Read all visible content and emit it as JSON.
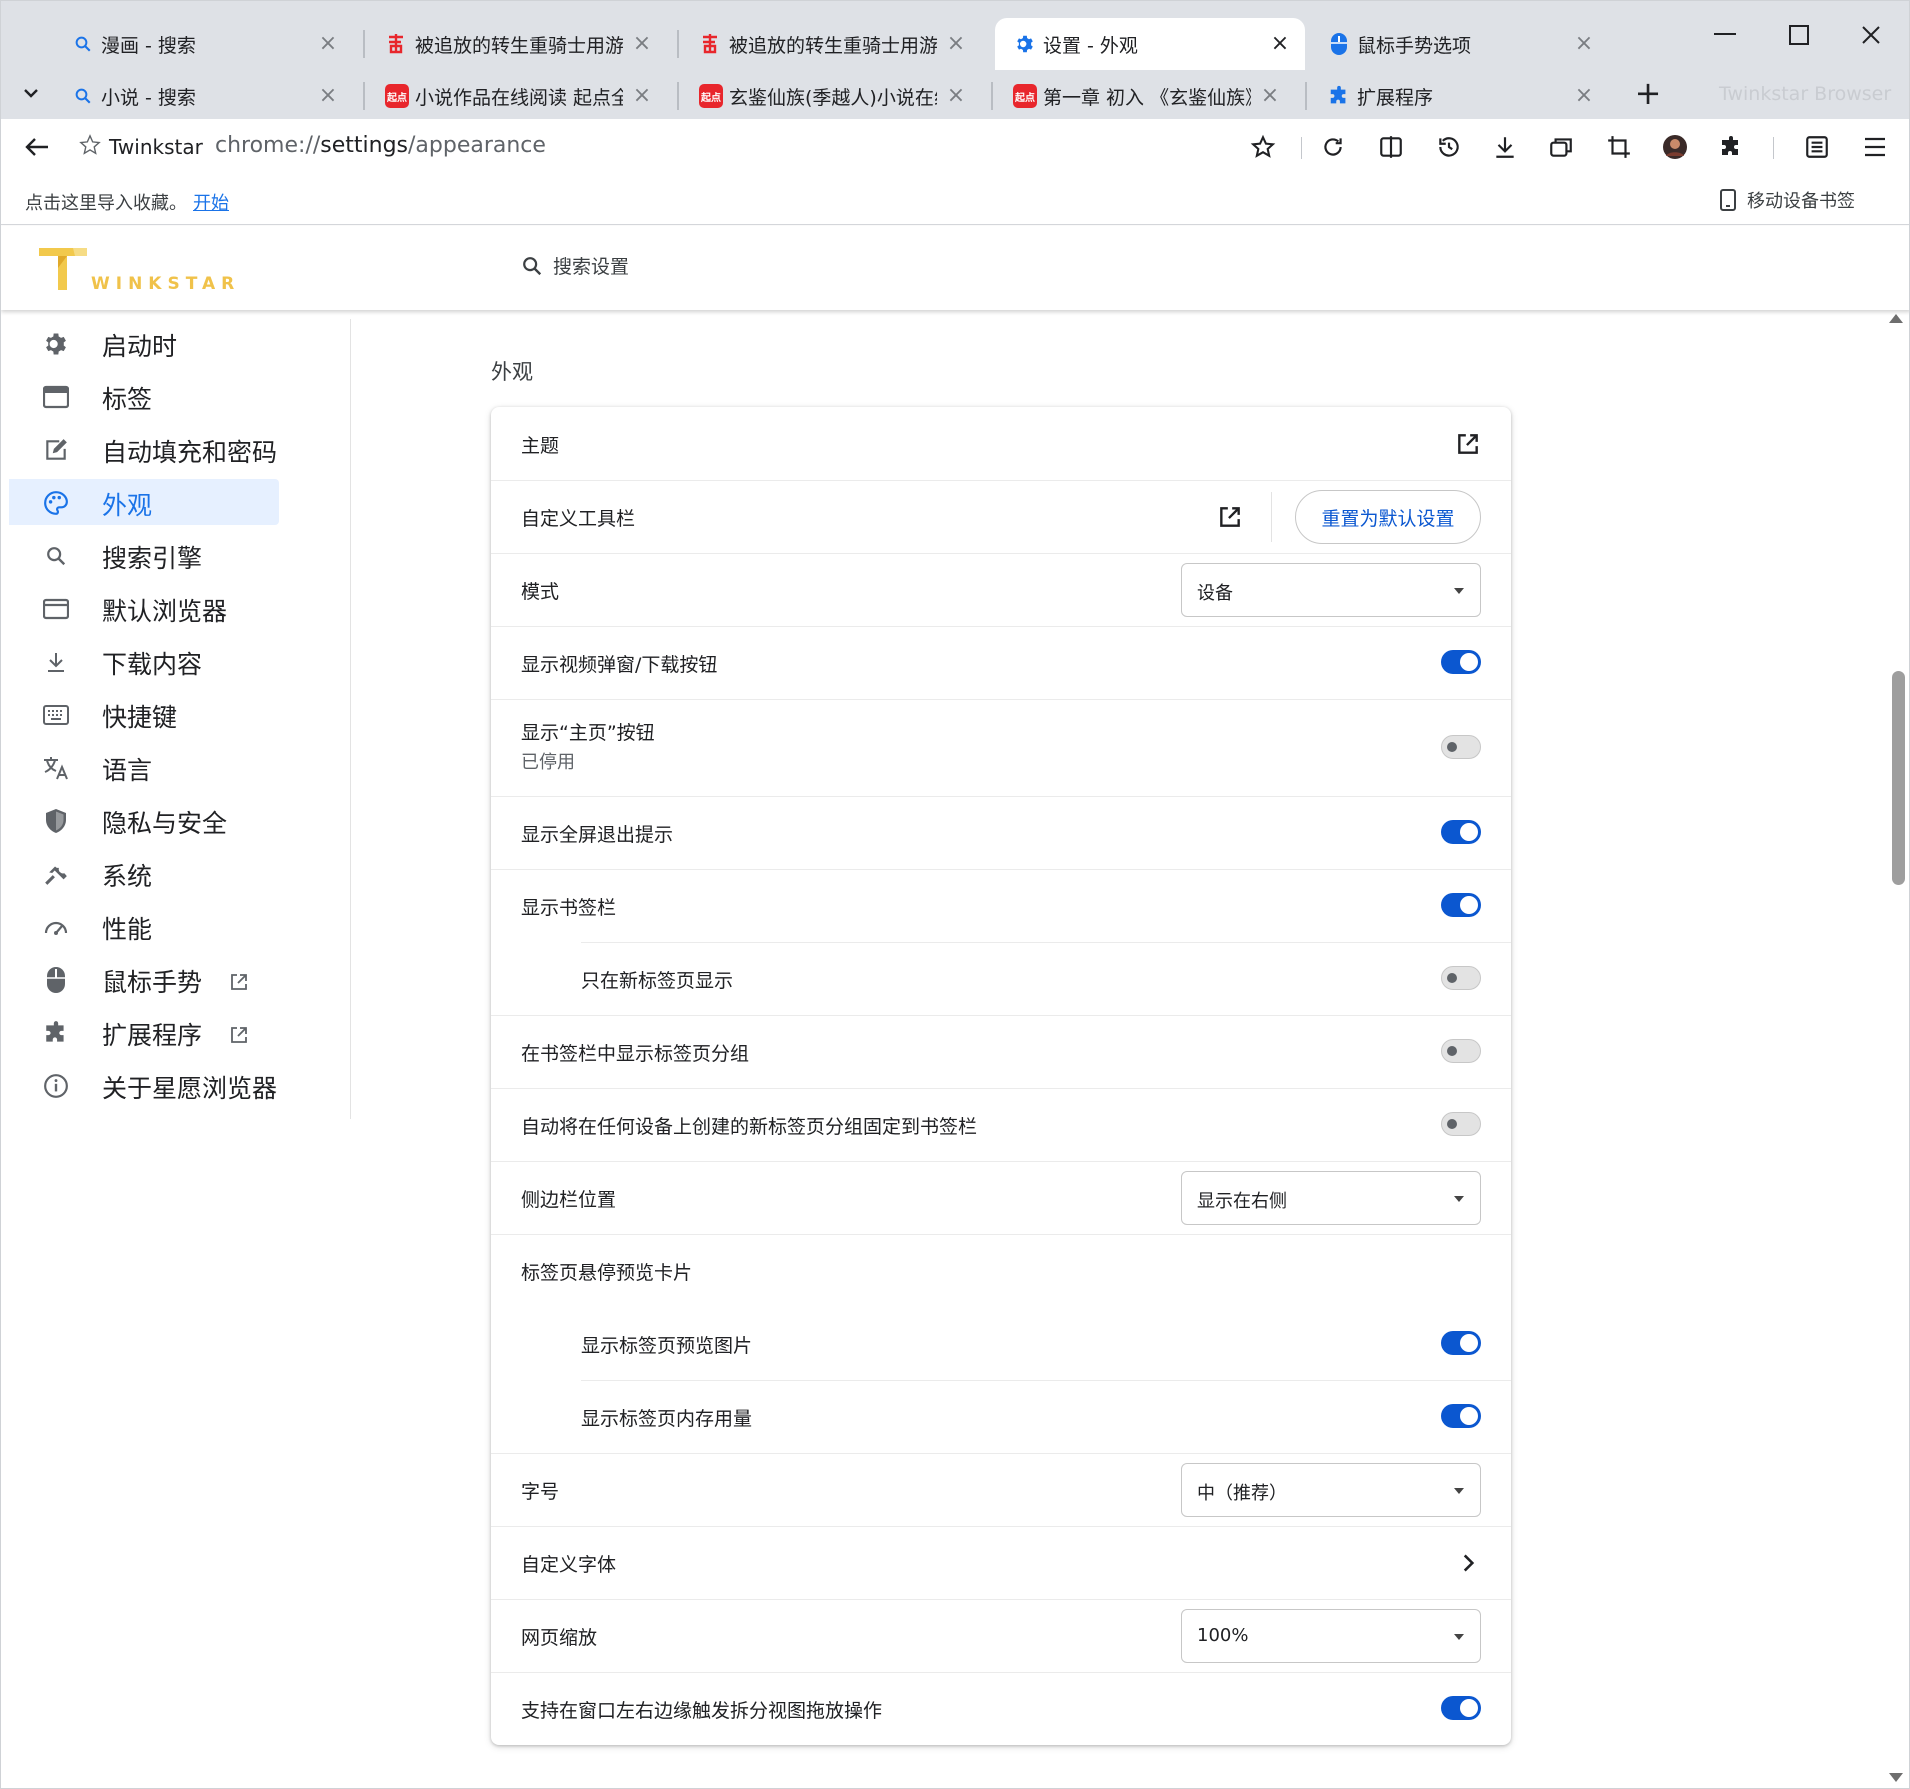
{
  "tabs_row1": [
    {
      "title": "漫画 - 搜索",
      "icon": "search-icon"
    },
    {
      "title": "被追放的转生重骑士用游戏知识开无双",
      "icon": "qidian-logo-icon"
    },
    {
      "title": "被追放的转生重骑士用游戏知识开无双",
      "icon": "qidian-logo-icon"
    },
    {
      "title": "设置 - 外观",
      "icon": "settings-gear-icon",
      "active": true
    },
    {
      "title": "鼠标手势选项",
      "icon": "mouse-icon"
    }
  ],
  "tabs_row2": [
    {
      "title": "小说 - 搜索",
      "icon": "search-icon"
    },
    {
      "title": "小说作品在线阅读 起点全",
      "icon": "qidian-badge-icon",
      "badge": "起点"
    },
    {
      "title": "玄鉴仙族(季越人)小说在线",
      "icon": "qidian-badge-icon",
      "badge": "起点"
    },
    {
      "title": "第一章 初入 《玄鉴仙族》",
      "icon": "qidian-badge-icon",
      "badge": "起点"
    },
    {
      "title": "扩展程序",
      "icon": "puzzle-icon"
    }
  ],
  "brand_ghost": "Twinkstar Browser",
  "omnibox": {
    "site": "Twinkstar",
    "url_prefix": "chrome://",
    "url_host": "settings",
    "url_path": "/appearance"
  },
  "bookmarks": {
    "hint": "点击这里导入收藏。",
    "link": "开始",
    "mobile": "移动设备书签"
  },
  "logo_text": "WINKSTAR",
  "search_placeholder": "搜索设置",
  "sidebar": [
    {
      "label": "启动时",
      "icon": "gear-icon"
    },
    {
      "label": "标签",
      "icon": "tab-window-icon"
    },
    {
      "label": "自动填充和密码",
      "icon": "edit-note-icon"
    },
    {
      "label": "外观",
      "icon": "palette-icon",
      "active": true
    },
    {
      "label": "搜索引擎",
      "icon": "search-icon"
    },
    {
      "label": "默认浏览器",
      "icon": "browser-window-icon"
    },
    {
      "label": "下载内容",
      "icon": "download-icon"
    },
    {
      "label": "快捷键",
      "icon": "keyboard-icon"
    },
    {
      "label": "语言",
      "icon": "translate-icon"
    },
    {
      "label": "隐私与安全",
      "icon": "shield-icon"
    },
    {
      "label": "系统",
      "icon": "wrench-icon"
    },
    {
      "label": "性能",
      "icon": "speedometer-icon"
    },
    {
      "label": "鼠标手势",
      "icon": "mouse-icon",
      "external": true
    },
    {
      "label": "扩展程序",
      "icon": "puzzle-icon",
      "external": true
    },
    {
      "label": "关于星愿浏览器",
      "icon": "info-icon"
    }
  ],
  "section_title": "外观",
  "rows": {
    "theme": {
      "label": "主题"
    },
    "toolbar": {
      "label": "自定义工具栏",
      "button": "重置为默认设置"
    },
    "mode": {
      "label": "模式",
      "value": "设备"
    },
    "video_popup": {
      "label": "显示视频弹窗/下载按钮",
      "on": true
    },
    "home_button": {
      "label": "显示“主页”按钮",
      "secondary": "已停用",
      "on": false
    },
    "fullscreen_exit": {
      "label": "显示全屏退出提示",
      "on": true
    },
    "bookmarks_bar": {
      "label": "显示书签栏",
      "on": true
    },
    "bookmarks_ntp_only": {
      "label": "只在新标签页显示",
      "on": false
    },
    "tab_groups_in_bar": {
      "label": "在书签栏中显示标签页分组",
      "on": false
    },
    "pin_groups": {
      "label": "自动将在任何设备上创建的新标签页分组固定到书签栏",
      "on": false
    },
    "sidebar_position": {
      "label": "侧边栏位置",
      "value": "显示在右侧"
    },
    "hover_card": {
      "label": "标签页悬停预览卡片"
    },
    "hover_image": {
      "label": "显示标签页预览图片",
      "on": true
    },
    "hover_memory": {
      "label": "显示标签页内存用量",
      "on": true
    },
    "font_size": {
      "label": "字号",
      "value": "中（推荐）"
    },
    "custom_fonts": {
      "label": "自定义字体"
    },
    "page_zoom": {
      "label": "网页缩放",
      "value": "100%"
    },
    "split_view": {
      "label": "支持在窗口左右边缘触发拆分视图拖放操作",
      "on": true
    }
  },
  "colors": {
    "accent": "#0b57d0",
    "link": "#1a73e8",
    "nav_active_bg": "#e6f0ff",
    "brand_gold": "#f0c24a",
    "qidian_red": "#e8262c"
  }
}
